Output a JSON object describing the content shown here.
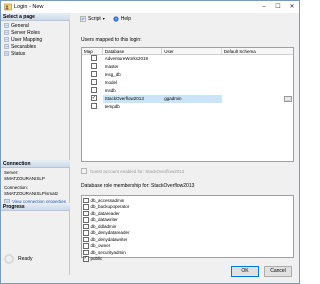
{
  "window": {
    "title": "Login - New"
  },
  "left": {
    "select_header": "Select a page",
    "pages": [
      {
        "label": "General"
      },
      {
        "label": "Server Roles"
      },
      {
        "label": "User Mapping"
      },
      {
        "label": "Securables"
      },
      {
        "label": "Status"
      }
    ],
    "connection_header": "Connection",
    "server_label": "Server:",
    "server_value": "SMATZOURANISLP",
    "connection_label": "Connection:",
    "connection_value": "SMATZOURANISLP\\smatz",
    "view_properties_link": "View connection properties",
    "progress_header": "Progress",
    "progress_status": "Ready"
  },
  "toolbar": {
    "script_label": "Script",
    "help_label": "Help"
  },
  "users_mapped": {
    "label": "Users mapped to this login:",
    "columns": [
      "Map",
      "Database",
      "User",
      "Default Schema"
    ],
    "rows": [
      {
        "checked": false,
        "database": "AdventureWorks2019",
        "user": "",
        "schema": ""
      },
      {
        "checked": false,
        "database": "master",
        "user": "",
        "schema": ""
      },
      {
        "checked": false,
        "database": "msg_db",
        "user": "",
        "schema": ""
      },
      {
        "checked": false,
        "database": "model",
        "user": "",
        "schema": ""
      },
      {
        "checked": false,
        "database": "msdb",
        "user": "",
        "schema": ""
      },
      {
        "checked": true,
        "database": "StackOverflow2013",
        "user": "ggadmin",
        "schema": ""
      },
      {
        "checked": false,
        "database": "tempdb",
        "user": "",
        "schema": ""
      }
    ],
    "ellipsis": "..."
  },
  "guest_account": {
    "label": "Guest account enabled for: StackOverflow2013"
  },
  "roles": {
    "label": "Database role membership for: StackOverflow2013",
    "items": [
      {
        "name": "db_accessadmin",
        "checked": false
      },
      {
        "name": "db_backupoperator",
        "checked": false
      },
      {
        "name": "db_datareader",
        "checked": false
      },
      {
        "name": "db_datawriter",
        "checked": false
      },
      {
        "name": "db_ddladmin",
        "checked": false
      },
      {
        "name": "db_denydatareader",
        "checked": false
      },
      {
        "name": "db_denydatawriter",
        "checked": false
      },
      {
        "name": "db_owner",
        "checked": false
      },
      {
        "name": "db_securityadmin",
        "checked": false
      },
      {
        "name": "public",
        "checked": true
      }
    ]
  },
  "buttons": {
    "ok": "OK",
    "cancel": "Cancel"
  }
}
